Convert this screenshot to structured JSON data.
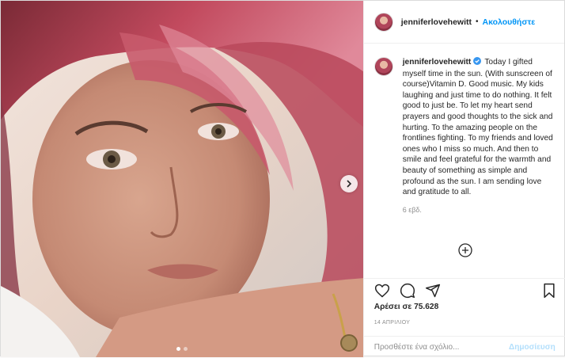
{
  "header": {
    "username": "jenniferlovehewitt",
    "separator": "•",
    "follow_label": "Ακολουθήστε"
  },
  "caption": {
    "username": "jenniferlovehewitt",
    "text": "Today I gifted myself time in the sun. (With sunscreen of course)Vitamin D. Good music. My kids laughing and just time to do nothing. It felt good to just be. To let my heart send prayers and good thoughts to the sick and hurting. To the amazing people on the frontlines fighting. To my friends and loved ones who I miss so much. And then to smile and feel grateful for the warmth and beauty of something as simple and profound as the sun. I am sending love and gratitude to all.",
    "age": "6 εβδ."
  },
  "footer": {
    "likes": "Αρέσει σε 75.628",
    "date": "14 ΑΠΡΙΛΙΟΥ",
    "comment_placeholder": "Προσθέστε ένα σχόλιο...",
    "post_label": "Δημοσίευση"
  },
  "colors": {
    "accent": "#0095f6",
    "post_disabled": "#b2dffc",
    "secondary_text": "#8e8e8e"
  },
  "icons": [
    "heart-icon",
    "comment-icon",
    "share-icon",
    "bookmark-icon",
    "verified-badge-icon",
    "add-circle-icon",
    "chevron-right-icon"
  ]
}
